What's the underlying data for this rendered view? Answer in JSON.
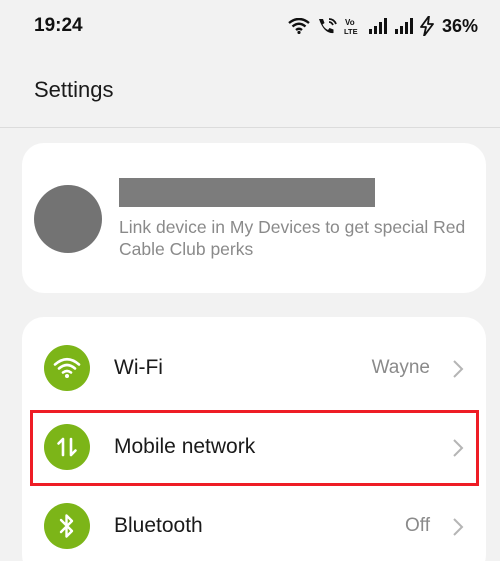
{
  "status_bar": {
    "time": "19:24",
    "battery": "36%",
    "icons": [
      "wifi-icon",
      "wifi-calling-icon",
      "volte-icon",
      "signal-icon",
      "signal-icon",
      "charging-icon"
    ]
  },
  "header": {
    "title": "Settings"
  },
  "account": {
    "avatar_icon": "avatar",
    "subtitle": "Link device in My Devices to get special Red Cable Club perks"
  },
  "settings": {
    "items": [
      {
        "label": "Wi-Fi",
        "value": "Wayne",
        "icon": "wifi-icon"
      },
      {
        "label": "Mobile network",
        "value": "",
        "icon": "mobile-data-icon"
      },
      {
        "label": "Bluetooth",
        "value": "Off",
        "icon": "bluetooth-icon"
      }
    ]
  },
  "colors": {
    "icon_green": "#7cb518",
    "highlight_red": "#ee1c25",
    "background": "#f2f2f2"
  }
}
